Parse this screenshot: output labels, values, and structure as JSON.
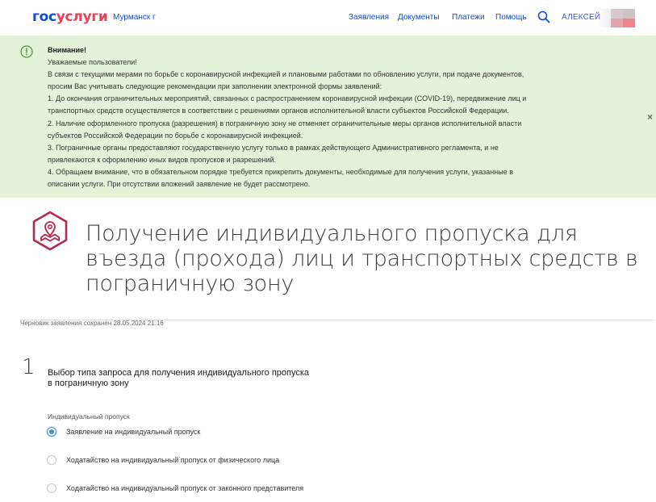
{
  "header": {
    "logo_part1": "гос",
    "logo_part2": "услуги",
    "region": "Мурманск г",
    "nav": [
      "Заявления",
      "Документы",
      "Платежи",
      "Помощь"
    ],
    "user_name": "АЛЕКСЕЙ",
    "brand_color": "#0d4cd3",
    "accent_color": "#ee3f58"
  },
  "notice": {
    "title": "Внимание!",
    "lines": [
      "Уважаемые пользователи!",
      "В связи с текущими мерами по борьбе с коронавирусной инфекцией и плановыми работами по обновлению услуги, при подаче документов,",
      "просим Вас учитывать следующие рекомендации при заполнении электронной формы заявлений:",
      "1. До окончания ограничительных мероприятий, связанных с распространением коронавирусной инфекции (COVID-19), передвижение лиц и",
      "транспортных средств осуществляется в соответствии с решениями органов исполнительной власти субъектов Российской Федерации.",
      "2. Наличие оформленного пропуска (разрешения) в пограничную зону не отменяет ограничительные меры органов исполнительной власти",
      "субъектов Российской Федерации по борьбе с коронавирусной инфекцией.",
      "3. Пограничные органы предоставляют государственную услугу только в рамках действующего Административного регламента, и не",
      "привлекаются к оформлению иных видов пропусков и разрешений.",
      "4. Обращаем внимание, что в обязательном порядке требуется прикрепить документы, необходимые для получения услуги, указанные в",
      "описании услуги. При отсутствии вложений заявление не будет рассмотрено."
    ],
    "close": "×",
    "background": "#e3f2d9"
  },
  "service": {
    "title": "Получение индивидуального пропуска для въезда (прохода) лиц и транспортных средств в пограничную зону",
    "icon": "map-pin-icon",
    "icon_color": "#b5294e"
  },
  "draft_status": "Черновик заявления сохранен 28.05.2024 21:16",
  "step": {
    "number": "1",
    "title": "Выбор типа запроса для получения индивидуального пропуска в пограничную зону",
    "group_label": "Индивидуальный пропуск",
    "options": [
      {
        "label": "Заявление на индивидуальный пропуск",
        "selected": true
      },
      {
        "label": "Ходатайство на индивидуальный пропуск от физического лица",
        "selected": false
      },
      {
        "label": "Ходатайство на индивидуальный пропуск от законного представителя",
        "selected": false
      }
    ]
  }
}
